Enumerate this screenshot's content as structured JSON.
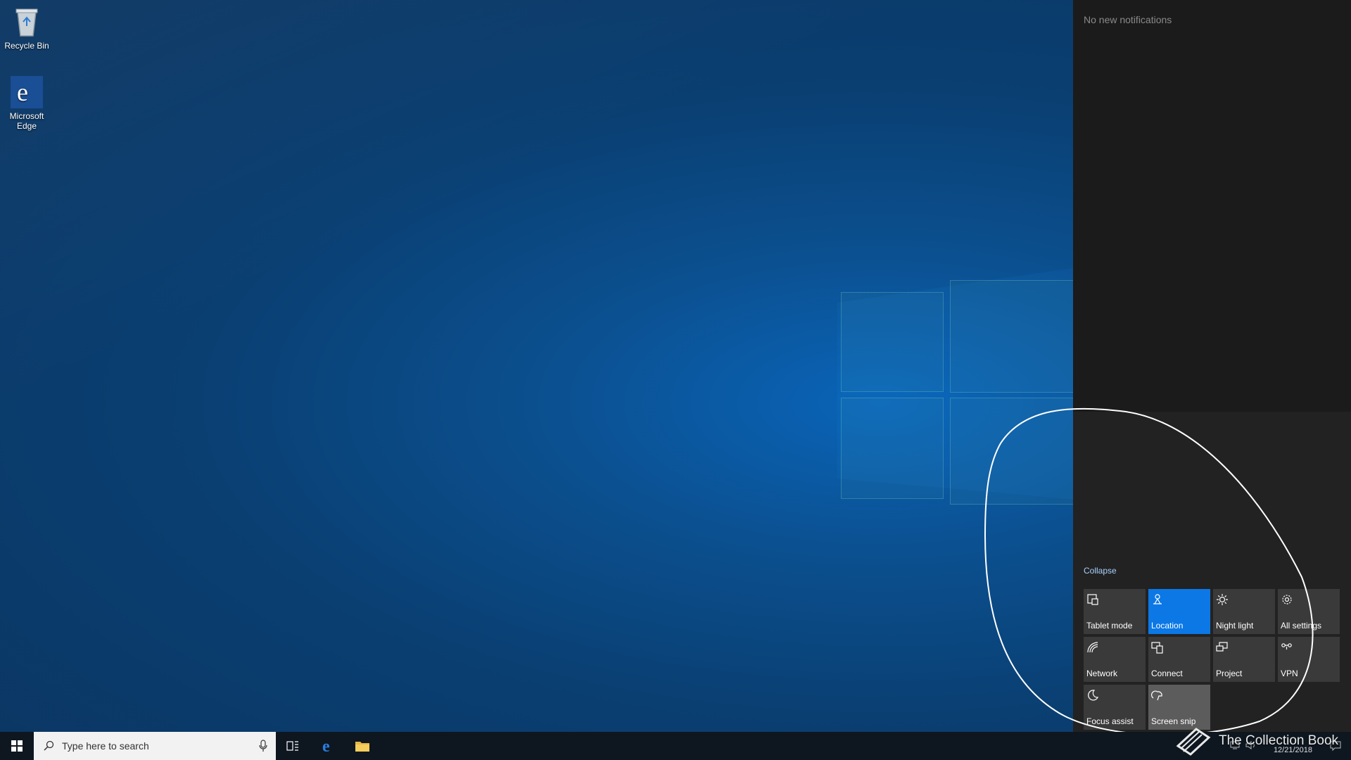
{
  "desktop": {
    "icons": [
      {
        "label": "Recycle Bin",
        "icon": "recycle-bin-icon"
      },
      {
        "label": "Microsoft Edge",
        "icon": "edge-icon"
      }
    ]
  },
  "action_center": {
    "notifications_text": "No new notifications",
    "collapse_label": "Collapse",
    "tiles": [
      {
        "label": "Tablet mode",
        "icon": "tablet-mode-icon",
        "state": "off"
      },
      {
        "label": "Location",
        "icon": "location-icon",
        "state": "on"
      },
      {
        "label": "Night light",
        "icon": "night-light-icon",
        "state": "off"
      },
      {
        "label": "All settings",
        "icon": "gear-icon",
        "state": "off"
      },
      {
        "label": "Network",
        "icon": "network-icon",
        "state": "off"
      },
      {
        "label": "Connect",
        "icon": "connect-icon",
        "state": "off"
      },
      {
        "label": "Project",
        "icon": "project-icon",
        "state": "off"
      },
      {
        "label": "VPN",
        "icon": "vpn-icon",
        "state": "off"
      },
      {
        "label": "Focus assist",
        "icon": "moon-icon",
        "state": "off"
      },
      {
        "label": "Screen snip",
        "icon": "screen-snip-icon",
        "state": "hover"
      }
    ]
  },
  "taskbar": {
    "search_placeholder": "Type here to search",
    "date": "12/21/2018"
  },
  "watermark": {
    "text": "The Collection Book"
  },
  "colors": {
    "accent": "#0b78e6",
    "panel": "#1b1b1b",
    "taskbar": "#0e1720"
  }
}
